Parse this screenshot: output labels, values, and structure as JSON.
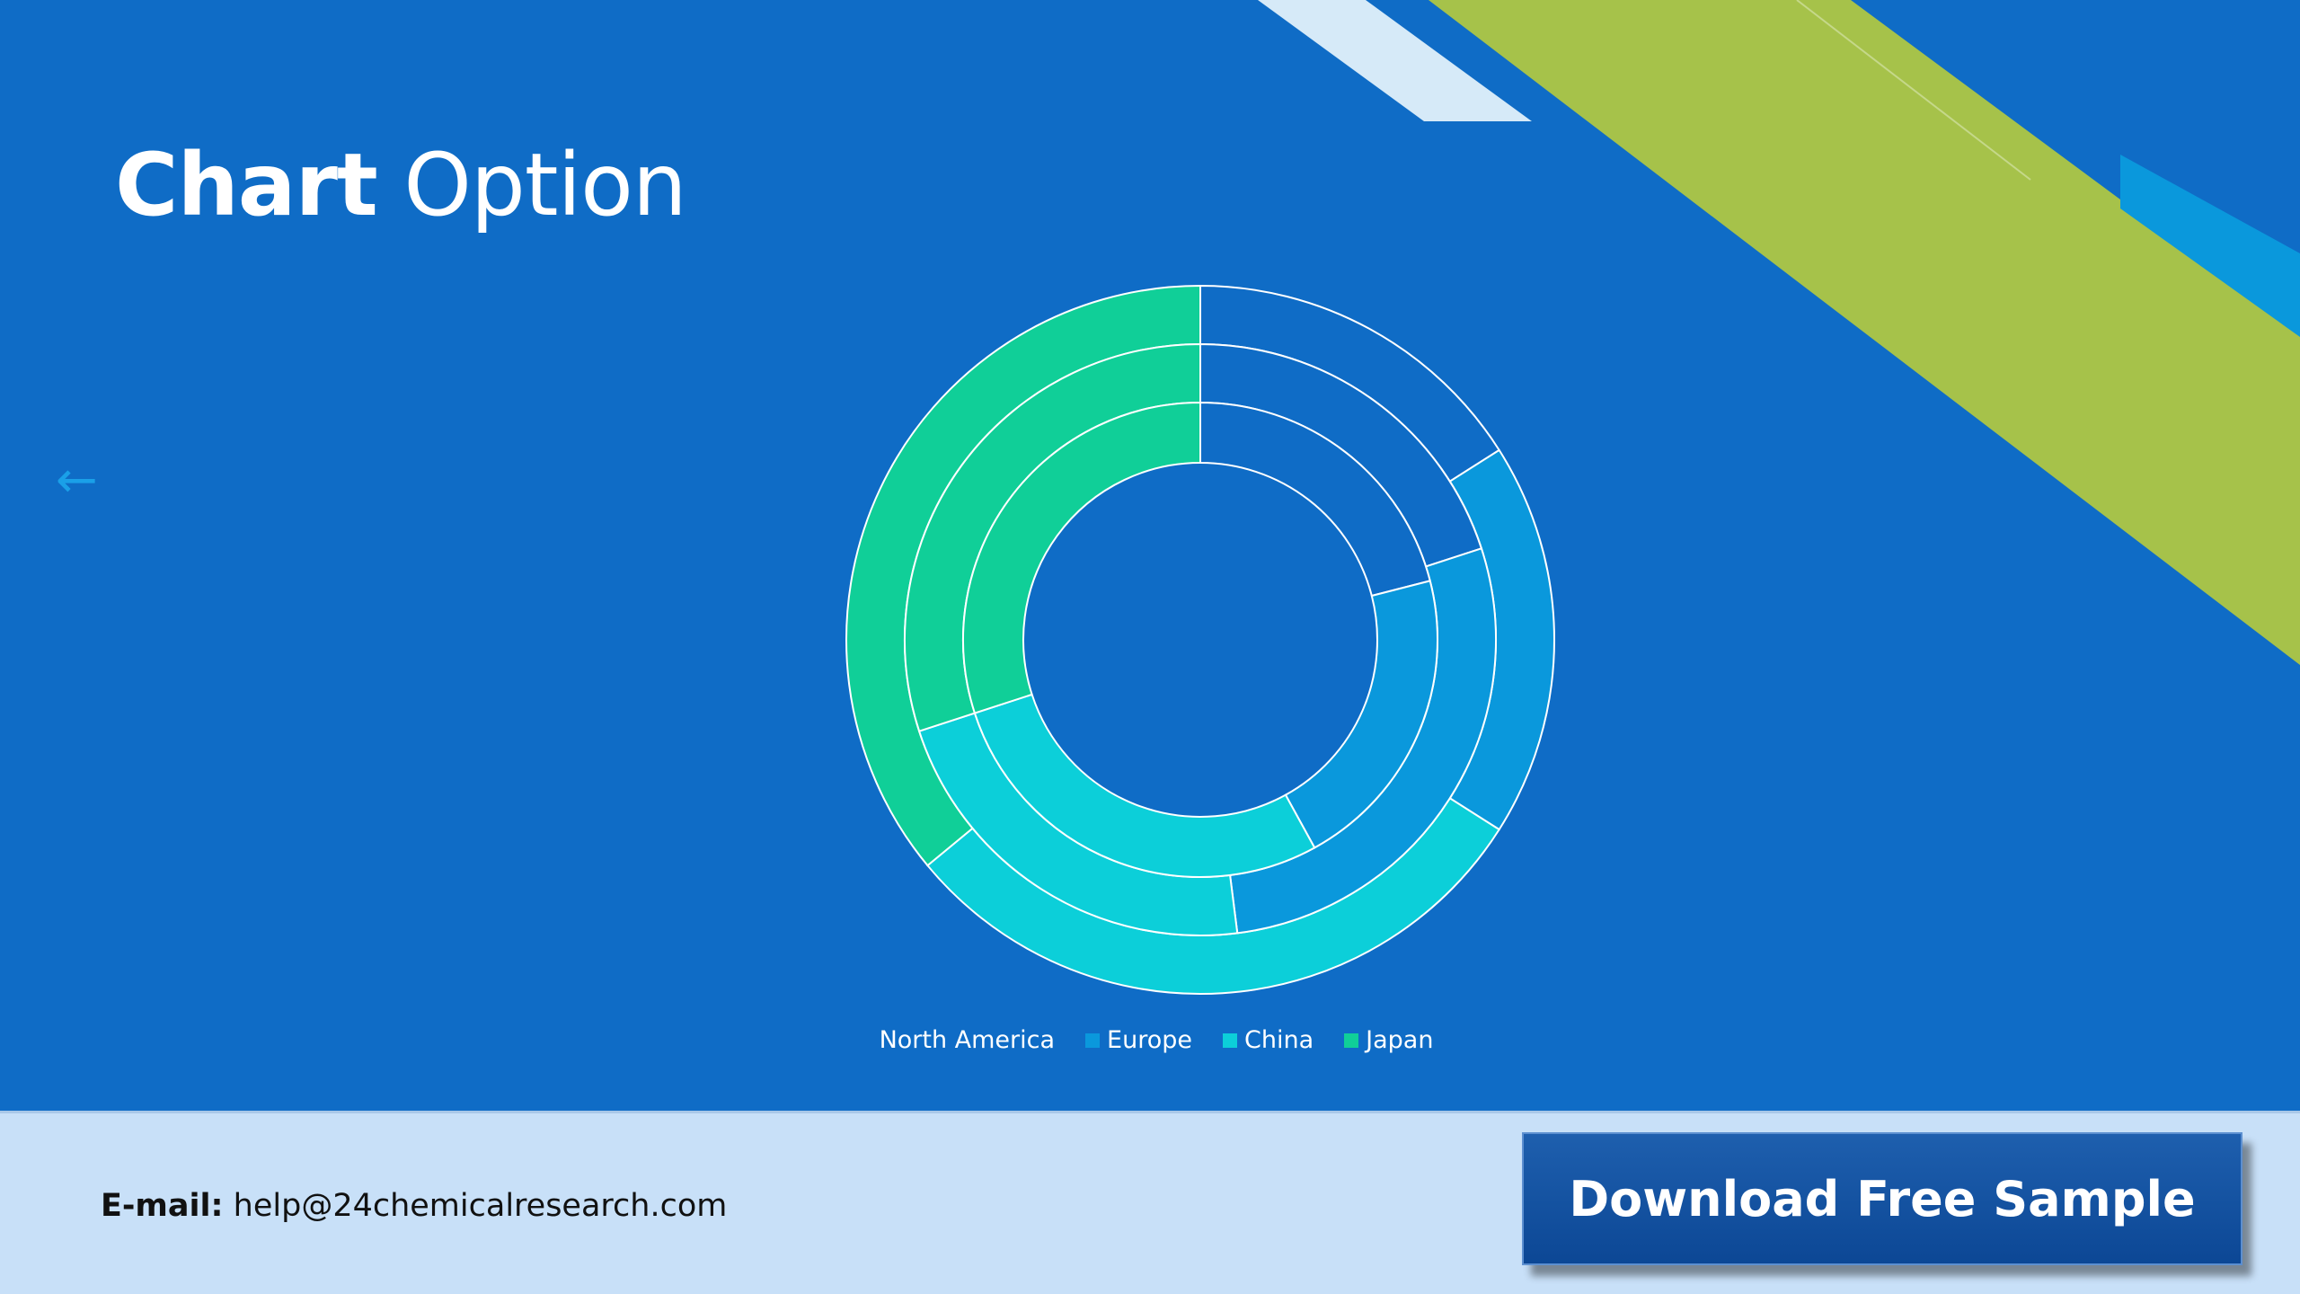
{
  "slide": {
    "title_bold": "Chart",
    "title_rest": "Option",
    "back_icon": "left-arrow-icon"
  },
  "colors": {
    "background": "#0f6cc6",
    "accent_green": "#a6c24a",
    "accent_light": "#d6eaf8",
    "north_america": "#0f6cc6",
    "europe": "#0a98dc",
    "china": "#0ccfd9",
    "japan": "#10cf98"
  },
  "chart_data": {
    "type": "doughnut",
    "categories": [
      "North America",
      "Europe",
      "China",
      "Japan"
    ],
    "series": [
      {
        "ring": "outer",
        "values": [
          16,
          18,
          30,
          36
        ]
      },
      {
        "ring": "middle",
        "values": [
          20,
          28,
          22,
          30
        ]
      },
      {
        "ring": "inner",
        "values": [
          21,
          21,
          28,
          30
        ]
      }
    ],
    "legend": [
      "North America",
      "Europe",
      "China",
      "Japan"
    ],
    "legend_position": "bottom"
  },
  "footer": {
    "email_label": "E-mail:",
    "email_value": "help@24chemicalresearch.com",
    "download_label": "Download Free Sample"
  }
}
